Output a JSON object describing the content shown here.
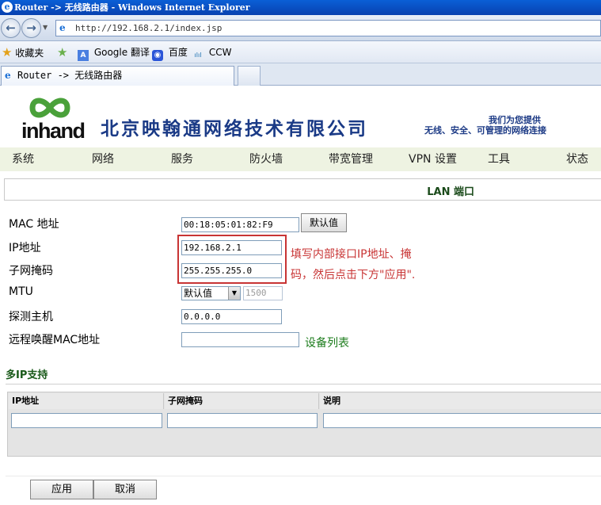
{
  "window": {
    "title": "Router -> 无线路由器 - Windows Internet Explorer"
  },
  "address_bar": {
    "url": "http://192.168.2.1/index.jsp"
  },
  "favorites_bar": {
    "items": [
      {
        "label": "收藏夹",
        "icon": "star-icon"
      },
      {
        "label": "Google 翻译",
        "icon": "google-translate-icon"
      },
      {
        "label": "百度",
        "icon": "baidu-paw-icon"
      },
      {
        "label": "CCW",
        "icon": "cisco-icon"
      }
    ]
  },
  "tab": {
    "title": "Router -> 无线路由器"
  },
  "header": {
    "logo_text": "inhand",
    "company_name": "北京映翰通网络技术有限公司",
    "slogan_line1": "我们为您提供",
    "slogan_line2": "无线、安全、可管理的网络连接"
  },
  "nav": {
    "items": [
      "系统",
      "网络",
      "服务",
      "防火墙",
      "带宽管理",
      "VPN 设置",
      "工具",
      "状态"
    ]
  },
  "section": {
    "title": "LAN 端口"
  },
  "form": {
    "mac_label": "MAC 地址",
    "mac_value": "00:18:05:01:82:F9",
    "default_button": "默认值",
    "ip_label": "IP地址",
    "ip_value": "192.168.2.1",
    "netmask_label": "子网掩码",
    "netmask_value": "255.255.255.0",
    "mtu_label": "MTU",
    "mtu_mode": "默认值",
    "mtu_value": "1500",
    "probe_label": "探测主机",
    "probe_value": "0.0.0.0",
    "wol_label": "远程唤醒MAC地址",
    "wol_value": "",
    "device_list_link": "设备列表"
  },
  "annotation": {
    "line1": "填写内部接口IP地址、掩",
    "line2": "码，然后点击下方\"应用\"."
  },
  "multi_ip": {
    "title": "多IP支持",
    "columns": [
      "IP地址",
      "子网掩码",
      "说明"
    ]
  },
  "footer": {
    "apply_label": "应用",
    "cancel_label": "取消"
  },
  "colors": {
    "annotation": "#c83434",
    "nav_bg": "#eef3e2",
    "company_text": "#1a3a86",
    "link": "#1c7c1c"
  }
}
